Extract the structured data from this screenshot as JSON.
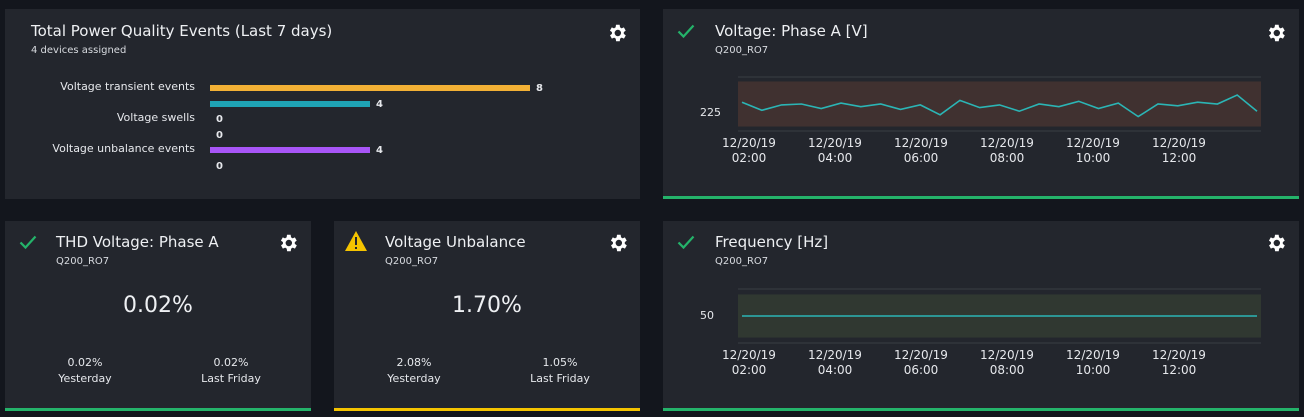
{
  "events_card": {
    "title": "Total Power Quality Events (Last 7 days)",
    "subtitle": "4 devices assigned",
    "gear_icon": "gear-icon"
  },
  "thd_card": {
    "title": "THD Voltage: Phase A",
    "subtitle": "Q200_RO7",
    "value": "0.02%",
    "yesterday_value": "0.02%",
    "yesterday_label": "Yesterday",
    "lastweek_value": "0.02%",
    "lastweek_label": "Last Friday",
    "status_icon": "check-icon",
    "status_color": "#24b36a"
  },
  "unbalance_card": {
    "title": "Voltage Unbalance",
    "subtitle": "Q200_RO7",
    "value": "1.70%",
    "yesterday_value": "2.08%",
    "yesterday_label": "Yesterday",
    "lastweek_value": "1.05%",
    "lastweek_label": "Last Friday",
    "status_icon": "warning-icon",
    "status_color": "#f5c400"
  },
  "voltage_card": {
    "title": "Voltage: Phase A [V]",
    "subtitle": "Q200_RO7",
    "status_icon": "check-icon"
  },
  "frequency_card": {
    "title": "Frequency [Hz]",
    "subtitle": "Q200_RO7",
    "status_icon": "check-icon"
  },
  "chart_data": [
    {
      "type": "bar",
      "orientation": "horizontal",
      "categories": [
        "Voltage transient events",
        "",
        "Voltage swells",
        "",
        "Voltage unbalance events",
        ""
      ],
      "values": [
        8,
        4,
        0,
        0,
        4,
        0
      ],
      "value_labels": [
        "8",
        "4",
        "0",
        "0",
        "4",
        "0"
      ],
      "colors": [
        "#f2b035",
        "#1fa3b5",
        "#f2b035",
        "#1fa3b5",
        "#a855f7",
        "#1fa3b5"
      ],
      "xlim": [
        0,
        8
      ]
    },
    {
      "type": "line",
      "title": "Voltage: Phase A [V]",
      "x": [
        "12/20/19 01:00",
        "12/20/19 01:30",
        "12/20/19 02:00",
        "12/20/19 02:30",
        "12/20/19 03:00",
        "12/20/19 03:30",
        "12/20/19 04:00",
        "12/20/19 04:30",
        "12/20/19 05:00",
        "12/20/19 05:30",
        "12/20/19 06:00",
        "12/20/19 06:30",
        "12/20/19 07:00",
        "12/20/19 07:30",
        "12/20/19 08:00",
        "12/20/19 08:30",
        "12/20/19 09:00",
        "12/20/19 09:30",
        "12/20/19 10:00",
        "12/20/19 10:30",
        "12/20/19 11:00",
        "12/20/19 11:30",
        "12/20/19 12:00",
        "12/20/19 12:30",
        "12/20/19 13:00",
        "12/20/19 13:30",
        "12/20/19 14:00"
      ],
      "series": [
        {
          "values": [
            226.2,
            225.3,
            225.9,
            226.0,
            225.5,
            226.1,
            225.7,
            226.0,
            225.4,
            225.9,
            224.8,
            226.4,
            225.6,
            225.9,
            225.2,
            226.0,
            225.7,
            226.3,
            225.5,
            226.1,
            224.6,
            226.0,
            225.8,
            226.2,
            226.0,
            227.0,
            225.2
          ]
        }
      ],
      "ytick_labels": [
        "225"
      ],
      "ylim": [
        223,
        229
      ],
      "xtick_labels": [
        [
          "12/20/19",
          "02:00"
        ],
        [
          "12/20/19",
          "04:00"
        ],
        [
          "12/20/19",
          "06:00"
        ],
        [
          "12/20/19",
          "08:00"
        ],
        [
          "12/20/19",
          "10:00"
        ],
        [
          "12/20/19",
          "12:00"
        ]
      ],
      "band": [
        223.5,
        228.5
      ],
      "line_color": "#2bb5b5"
    },
    {
      "type": "line",
      "title": "Frequency [Hz]",
      "x": [
        "12/20/19 01:00",
        "12/20/19 14:00"
      ],
      "series": [
        {
          "values": [
            50.0,
            50.0
          ]
        }
      ],
      "ytick_labels": [
        "50"
      ],
      "ylim": [
        49.0,
        51.0
      ],
      "xtick_labels": [
        [
          "12/20/19",
          "02:00"
        ],
        [
          "12/20/19",
          "04:00"
        ],
        [
          "12/20/19",
          "06:00"
        ],
        [
          "12/20/19",
          "08:00"
        ],
        [
          "12/20/19",
          "10:00"
        ],
        [
          "12/20/19",
          "12:00"
        ]
      ],
      "band": [
        49.2,
        50.8
      ],
      "line_color": "#2bb5b5"
    }
  ]
}
